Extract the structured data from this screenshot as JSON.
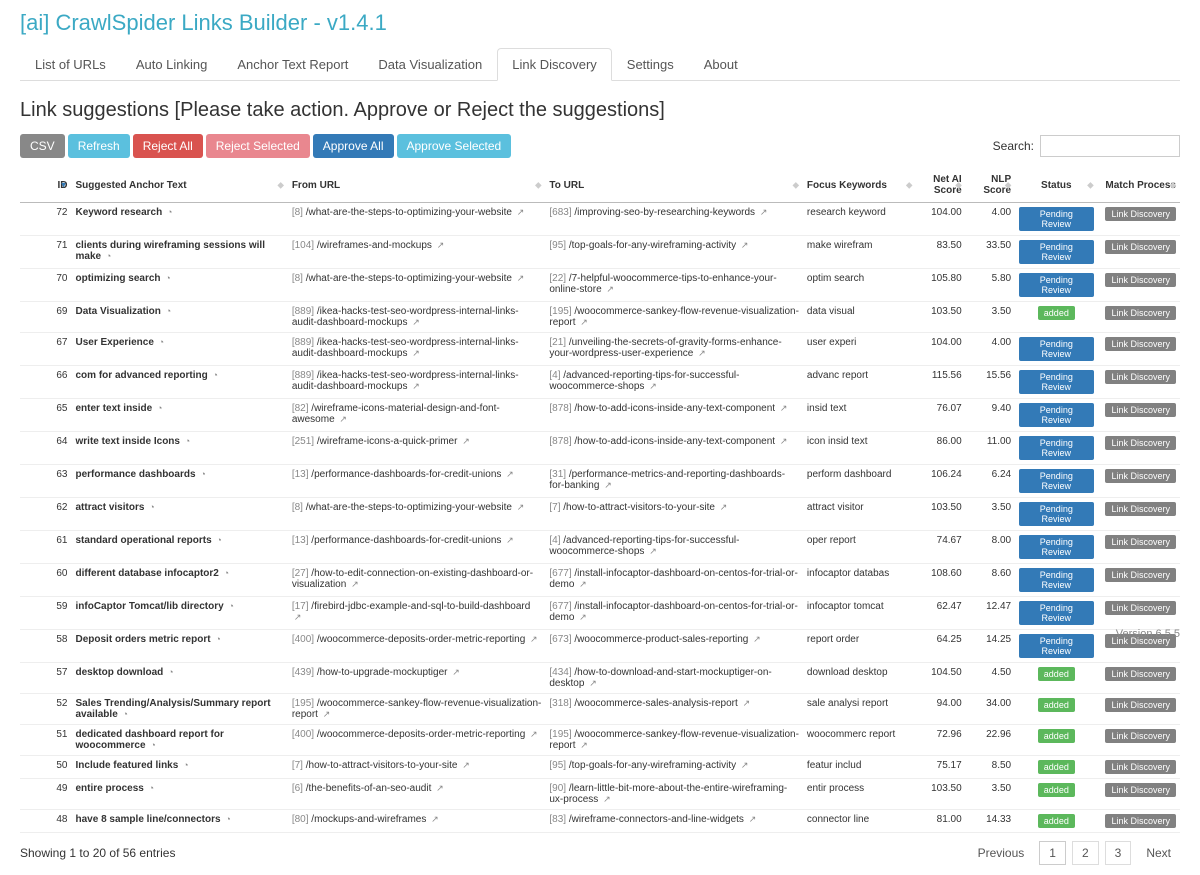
{
  "title": "[ai] CrawlSpider Links Builder - v1.4.1",
  "tabs": [
    "List of URLs",
    "Auto Linking",
    "Anchor Text Report",
    "Data Visualization",
    "Link Discovery",
    "Settings",
    "About"
  ],
  "active_tab": 4,
  "subtitle": "Link suggestions [Please take action. Approve or Reject the suggestions]",
  "buttons": {
    "csv": "CSV",
    "refresh": "Refresh",
    "rejectAll": "Reject All",
    "rejectSel": "Reject Selected",
    "approveAll": "Approve All",
    "approveSel": "Approve Selected"
  },
  "search_label": "Search:",
  "columns": {
    "id": "ID",
    "anchor": "Suggested Anchor Text",
    "from": "From URL",
    "to": "To URL",
    "kw": "Focus Keywords",
    "net": "Net AI Score",
    "nlp": "NLP Score",
    "status": "Status",
    "match": "Match Process"
  },
  "rows": [
    {
      "id": 72,
      "anchor": "Keyword research",
      "from_pre": "[8]",
      "from": "/what-are-the-steps-to-optimizing-your-website",
      "to_pre": "[683]",
      "to": "/improving-seo-by-researching-keywords",
      "kw": "research keyword",
      "net": "104.00",
      "nlp": "4.00",
      "status": "Pending Review",
      "match": "Link Discovery"
    },
    {
      "id": 71,
      "anchor": "clients during wireframing sessions will make",
      "from_pre": "[104]",
      "from": "/wireframes-and-mockups",
      "to_pre": "[95]",
      "to": "/top-goals-for-any-wireframing-activity",
      "kw": "make wirefram",
      "net": "83.50",
      "nlp": "33.50",
      "status": "Pending Review",
      "match": "Link Discovery"
    },
    {
      "id": 70,
      "anchor": "optimizing search",
      "from_pre": "[8]",
      "from": "/what-are-the-steps-to-optimizing-your-website",
      "to_pre": "[22]",
      "to": "/7-helpful-woocommerce-tips-to-enhance-your-online-store",
      "kw": "optim search",
      "net": "105.80",
      "nlp": "5.80",
      "status": "Pending Review",
      "match": "Link Discovery"
    },
    {
      "id": 69,
      "anchor": "Data Visualization",
      "from_pre": "[889]",
      "from": "/ikea-hacks-test-seo-wordpress-internal-links-audit-dashboard-mockups",
      "from_bold": "wordpress-internal-links-audit-dashboard-",
      "to_pre": "[195]",
      "to": "/woocommerce-sankey-flow-revenue-visualization-report",
      "kw": "data visual",
      "net": "103.50",
      "nlp": "3.50",
      "status": "added",
      "match": "Link Discovery"
    },
    {
      "id": 67,
      "anchor": "User Experience",
      "from_pre": "[889]",
      "from": "/ikea-hacks-test-seo-wordpress-internal-links-audit-dashboard-mockups",
      "from_bold": "wordpress-internal-links-audit-dashboard-",
      "to_pre": "[21]",
      "to": "/unveiling-the-secrets-of-gravity-forms-enhance-your-wordpress-user-experience",
      "to_bold": "iling-the-secrets-of",
      "kw": "user experi",
      "net": "104.00",
      "nlp": "4.00",
      "status": "Pending Review",
      "match": "Link Discovery"
    },
    {
      "id": 66,
      "anchor": "com for advanced reporting",
      "from_pre": "[889]",
      "from": "/ikea-hacks-test-seo-wordpress-internal-links-audit-dashboard-mockups",
      "from_bold": "wordpress-internal-links-audit-dashboard-",
      "to_pre": "[4]",
      "to": "/advanced-reporting-tips-for-successful-woocommerce-shops",
      "kw": "advanc report",
      "net": "115.56",
      "nlp": "15.56",
      "status": "Pending Review",
      "match": "Link Discovery"
    },
    {
      "id": 65,
      "anchor": "enter text inside",
      "from_pre": "[82]",
      "from": "/wireframe-icons-material-design-and-font-awesome",
      "to_pre": "[878]",
      "to": "/how-to-add-icons-inside-any-text-component",
      "kw": "insid text",
      "net": "76.07",
      "nlp": "9.40",
      "status": "Pending Review",
      "match": "Link Discovery"
    },
    {
      "id": 64,
      "anchor": "write text inside Icons",
      "from_pre": "[251]",
      "from": "/wireframe-icons-a-quick-primer",
      "to_pre": "[878]",
      "to": "/how-to-add-icons-inside-any-text-component",
      "kw": "icon insid text",
      "net": "86.00",
      "nlp": "11.00",
      "status": "Pending Review",
      "match": "Link Discovery"
    },
    {
      "id": 63,
      "anchor": "performance dashboards",
      "from_pre": "[13]",
      "from": "/performance-dashboards-for-credit-unions",
      "to_pre": "[31]",
      "to": "/performance-metrics-and-reporting-dashboards-for-banking",
      "kw": "perform dashboard",
      "net": "106.24",
      "nlp": "6.24",
      "status": "Pending Review",
      "match": "Link Discovery"
    },
    {
      "id": 62,
      "anchor": "attract visitors",
      "from_pre": "[8]",
      "from": "/what-are-the-steps-to-optimizing-your-website",
      "to_pre": "[7]",
      "to": "/how-to-attract-visitors-to-your-site",
      "kw": "attract visitor",
      "net": "103.50",
      "nlp": "3.50",
      "status": "Pending Review",
      "match": "Link Discovery"
    },
    {
      "id": 61,
      "anchor": "standard operational reports",
      "from_pre": "[13]",
      "from": "/performance-dashboards-for-credit-unions",
      "to_pre": "[4]",
      "to": "/advanced-reporting-tips-for-successful-woocommerce-shops",
      "kw": "oper report",
      "net": "74.67",
      "nlp": "8.00",
      "status": "Pending Review",
      "match": "Link Discovery"
    },
    {
      "id": 60,
      "anchor": "different database infocaptor2",
      "from_pre": "[27]",
      "from": "/how-to-edit-connection-on-existing-dashboard-or-visualization",
      "to_pre": "[677]",
      "to": "/install-infocaptor-dashboard-on-centos-for-trial-or-demo",
      "kw": "infocaptor databas",
      "net": "108.60",
      "nlp": "8.60",
      "status": "Pending Review",
      "match": "Link Discovery"
    },
    {
      "id": 59,
      "anchor": "infoCaptor Tomcat/lib directory",
      "from_pre": "[17]",
      "from": "/firebird-jdbc-example-and-sql-to-build-dashboard",
      "to_pre": "[677]",
      "to": "/install-infocaptor-dashboard-on-centos-for-trial-or-demo",
      "kw": "infocaptor tomcat",
      "net": "62.47",
      "nlp": "12.47",
      "status": "Pending Review",
      "match": "Link Discovery"
    },
    {
      "id": 58,
      "anchor": "Deposit orders metric report",
      "from_pre": "[400]",
      "from": "/woocommerce-deposits-order-metric-reporting",
      "to_pre": "[673]",
      "to": "/woocommerce-product-sales-reporting",
      "kw": "report order",
      "net": "64.25",
      "nlp": "14.25",
      "status": "Pending Review",
      "match": "Link Discovery"
    },
    {
      "id": 57,
      "anchor": "desktop download",
      "from_pre": "[439]",
      "from": "/how-to-upgrade-mockuptiger",
      "to_pre": "[434]",
      "to": "/how-to-download-and-start-mockuptiger-on-desktop",
      "kw": "download desktop",
      "net": "104.50",
      "nlp": "4.50",
      "status": "added",
      "match": "Link Discovery"
    },
    {
      "id": 52,
      "anchor": "Sales Trending/Analysis/Summary report available",
      "from_pre": "[195]",
      "from": "/woocommerce-sankey-flow-revenue-visualization-report",
      "to_pre": "[318]",
      "to": "/woocommerce-sales-analysis-report",
      "kw": "sale analysi report",
      "net": "94.00",
      "nlp": "34.00",
      "status": "added",
      "match": "Link Discovery"
    },
    {
      "id": 51,
      "anchor": "dedicated dashboard report for woocommerce",
      "from_pre": "[400]",
      "from": "/woocommerce-deposits-order-metric-reporting",
      "to_pre": "[195]",
      "to": "/woocommerce-sankey-flow-revenue-visualization-report",
      "kw": "woocommerc report",
      "net": "72.96",
      "nlp": "22.96",
      "status": "added",
      "match": "Link Discovery"
    },
    {
      "id": 50,
      "anchor": "Include featured links",
      "from_pre": "[7]",
      "from": "/how-to-attract-visitors-to-your-site",
      "to_pre": "[95]",
      "to": "/top-goals-for-any-wireframing-activity",
      "kw": "featur includ",
      "net": "75.17",
      "nlp": "8.50",
      "status": "added",
      "match": "Link Discovery"
    },
    {
      "id": 49,
      "anchor": "entire process",
      "from_pre": "[6]",
      "from": "/the-benefits-of-an-seo-audit",
      "to_pre": "[90]",
      "to": "/learn-little-bit-more-about-the-entire-wireframing-ux-process",
      "kw": "entir process",
      "net": "103.50",
      "nlp": "3.50",
      "status": "added",
      "match": "Link Discovery"
    },
    {
      "id": 48,
      "anchor": "have 8 sample line/connectors",
      "from_pre": "[80]",
      "from": "/mockups-and-wireframes",
      "to_pre": "[83]",
      "to": "/wireframe-connectors-and-line-widgets",
      "kw": "connector line",
      "net": "81.00",
      "nlp": "14.33",
      "status": "added",
      "match": "Link Discovery"
    }
  ],
  "entries_text": "Showing 1 to 20 of 56 entries",
  "pagination": {
    "prev": "Previous",
    "next": "Next",
    "pages": [
      "1",
      "2",
      "3"
    ],
    "active": 0
  },
  "version": "Version 6.5.5"
}
